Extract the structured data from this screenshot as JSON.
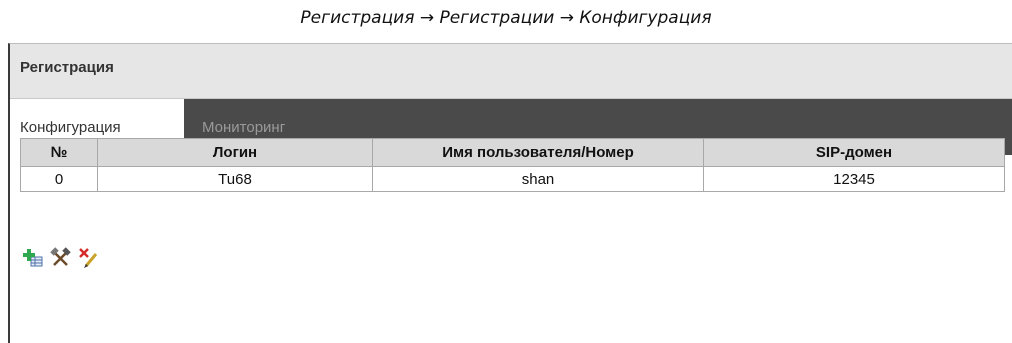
{
  "caption": "Регистрация → Регистрации → Конфигурация",
  "panel": {
    "title": "Регистрация"
  },
  "tabs": [
    {
      "label": "Конфигурация",
      "active": true
    },
    {
      "label": "Мониторинг",
      "active": false
    }
  ],
  "table": {
    "columns": [
      "№",
      "Логин",
      "Имя пользователя/Номер",
      "SIP-домен"
    ],
    "rows": [
      [
        "0",
        "Tu68",
        "shan",
        "12345"
      ]
    ]
  },
  "toolbar_icons": [
    "add-icon",
    "edit-icon",
    "delete-icon"
  ],
  "colors": {
    "tab_bar": "#4a4a4a",
    "header_bg": "#e6e6e6",
    "table_header_bg": "#d9d9d9"
  }
}
